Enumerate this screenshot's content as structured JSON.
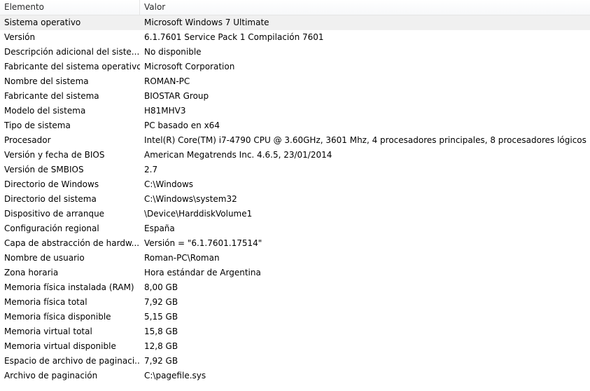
{
  "columns": {
    "element": "Elemento",
    "value": "Valor"
  },
  "rows": [
    {
      "element": "Sistema operativo",
      "value": "Microsoft Windows 7 Ultimate"
    },
    {
      "element": "Versión",
      "value": "6.1.7601 Service Pack 1 Compilación 7601"
    },
    {
      "element": "Descripción adicional del siste...",
      "value": "No disponible"
    },
    {
      "element": "Fabricante del sistema operativo",
      "value": "Microsoft Corporation"
    },
    {
      "element": "Nombre del sistema",
      "value": "ROMAN-PC"
    },
    {
      "element": "Fabricante del sistema",
      "value": "BIOSTAR Group"
    },
    {
      "element": "Modelo del sistema",
      "value": "H81MHV3"
    },
    {
      "element": "Tipo de sistema",
      "value": "PC basado en x64"
    },
    {
      "element": "Procesador",
      "value": "Intel(R) Core(TM) i7-4790 CPU @ 3.60GHz, 3601 Mhz, 4 procesadores principales, 8 procesadores lógicos"
    },
    {
      "element": "Versión y fecha de BIOS",
      "value": "American Megatrends Inc. 4.6.5, 23/01/2014"
    },
    {
      "element": "Versión de SMBIOS",
      "value": "2.7"
    },
    {
      "element": "Directorio de Windows",
      "value": "C:\\Windows"
    },
    {
      "element": "Directorio del sistema",
      "value": "C:\\Windows\\system32"
    },
    {
      "element": "Dispositivo de arranque",
      "value": "\\Device\\HarddiskVolume1"
    },
    {
      "element": "Configuración regional",
      "value": "España"
    },
    {
      "element": "Capa de abstracción de hardw...",
      "value": "Versión = \"6.1.7601.17514\""
    },
    {
      "element": "Nombre de usuario",
      "value": "Roman-PC\\Roman"
    },
    {
      "element": "Zona horaria",
      "value": "Hora estándar de Argentina"
    },
    {
      "element": "Memoria física instalada (RAM)",
      "value": "8,00 GB"
    },
    {
      "element": "Memoria física total",
      "value": "7,92 GB"
    },
    {
      "element": "Memoria física disponible",
      "value": "5,15 GB"
    },
    {
      "element": "Memoria virtual total",
      "value": "15,8 GB"
    },
    {
      "element": "Memoria virtual disponible",
      "value": "12,8 GB"
    },
    {
      "element": "Espacio de archivo de paginaci...",
      "value": "7,92 GB"
    },
    {
      "element": "Archivo de paginación",
      "value": "C:\\pagefile.sys"
    }
  ]
}
